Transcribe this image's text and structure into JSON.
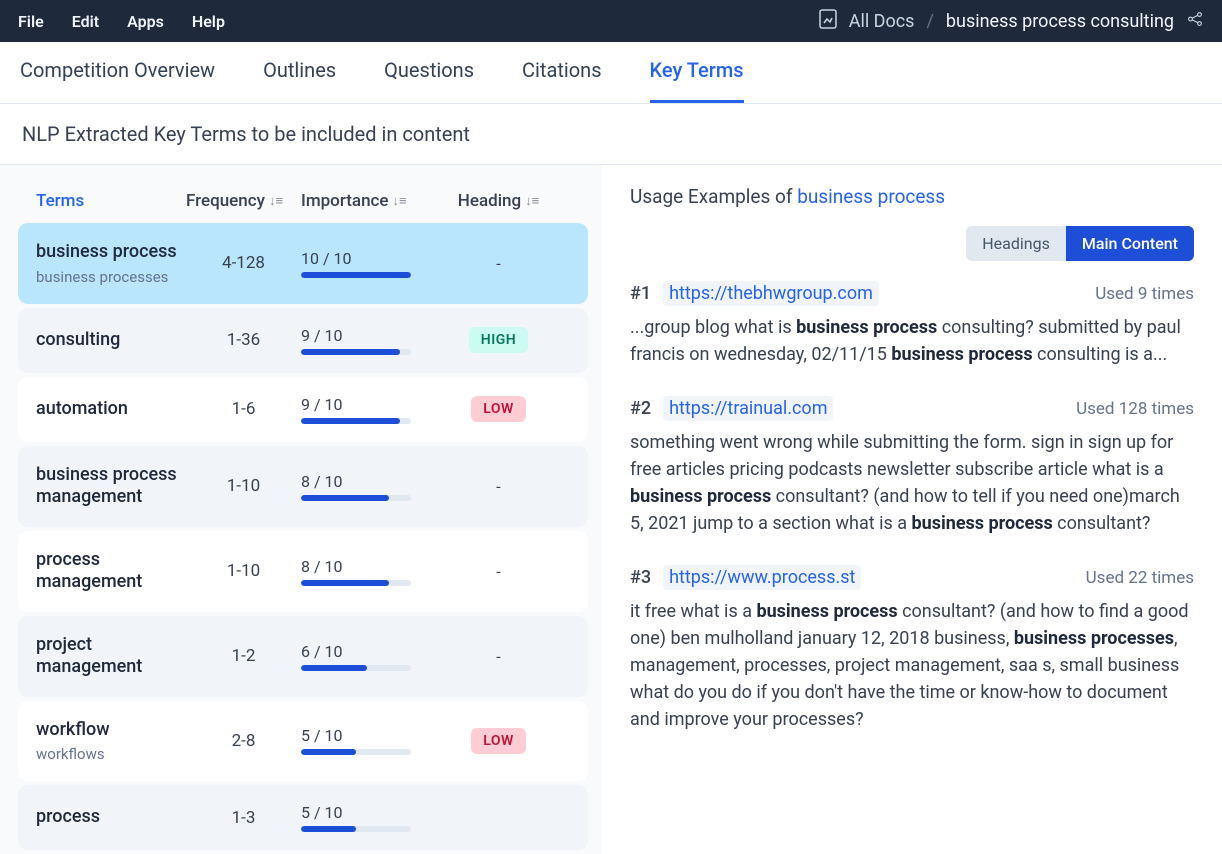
{
  "menu": [
    "File",
    "Edit",
    "Apps",
    "Help"
  ],
  "breadcrumb": {
    "all_docs": "All Docs",
    "sep": "/",
    "title": "business process consulting"
  },
  "tabs": [
    "Competition Overview",
    "Outlines",
    "Questions",
    "Citations",
    "Key Terms"
  ],
  "active_tab": 4,
  "subtitle": "NLP Extracted Key Terms to be included in content",
  "table_headers": {
    "terms": "Terms",
    "frequency": "Frequency",
    "importance": "Importance",
    "heading": "Heading"
  },
  "terms": [
    {
      "name": "business process",
      "sub": "business processes",
      "freq": "4-128",
      "imp": "10 / 10",
      "imp_val": 100,
      "heading": "-",
      "badge": "",
      "row": "selected"
    },
    {
      "name": "consulting",
      "sub": "",
      "freq": "1-36",
      "imp": "9 / 10",
      "imp_val": 90,
      "heading": "",
      "badge": "HIGH",
      "row": "alt"
    },
    {
      "name": "automation",
      "sub": "",
      "freq": "1-6",
      "imp": "9 / 10",
      "imp_val": 90,
      "heading": "",
      "badge": "LOW",
      "row": "plain"
    },
    {
      "name": "business process management",
      "sub": "",
      "freq": "1-10",
      "imp": "8 / 10",
      "imp_val": 80,
      "heading": "-",
      "badge": "",
      "row": "alt"
    },
    {
      "name": "process management",
      "sub": "",
      "freq": "1-10",
      "imp": "8 / 10",
      "imp_val": 80,
      "heading": "-",
      "badge": "",
      "row": "plain"
    },
    {
      "name": "project management",
      "sub": "",
      "freq": "1-2",
      "imp": "6 / 10",
      "imp_val": 60,
      "heading": "-",
      "badge": "",
      "row": "alt"
    },
    {
      "name": "workflow",
      "sub": "workflows",
      "freq": "2-8",
      "imp": "5 / 10",
      "imp_val": 50,
      "heading": "",
      "badge": "LOW",
      "row": "plain"
    },
    {
      "name": "process",
      "sub": "",
      "freq": "1-3",
      "imp": "5 / 10",
      "imp_val": 50,
      "heading": "",
      "badge": "",
      "row": "alt"
    }
  ],
  "usage_label": "Usage Examples of ",
  "usage_keyword": "business process",
  "toggles": {
    "headings": "Headings",
    "main": "Main Content"
  },
  "examples": [
    {
      "rank": "#1",
      "url": "https://thebhwgroup.com",
      "count": "Used 9 times",
      "html": "...group blog what is <b>business process</b> consulting? submitted by paul francis on wednesday, 02/11/15 <b>business process</b> consulting is a..."
    },
    {
      "rank": "#2",
      "url": "https://trainual.com",
      "count": "Used 128 times",
      "html": "something went wrong while submitting the form. sign in sign up for free articles pricing podcasts newsletter subscribe article what is a <b>business process</b> consultant? (and how to tell if you need one)march 5, 2021 jump to a section what is a <b>business process</b> consultant?"
    },
    {
      "rank": "#3",
      "url": "https://www.process.st",
      "count": "Used 22 times",
      "html": "it free what is a <b>business process</b> consultant? (and how to find a good one) ben mulholland january 12, 2018 business, <b>business processes</b>, management, processes, project management, saa s, small business what do you do if you don't have the time or know-how to document and improve your processes?"
    }
  ]
}
